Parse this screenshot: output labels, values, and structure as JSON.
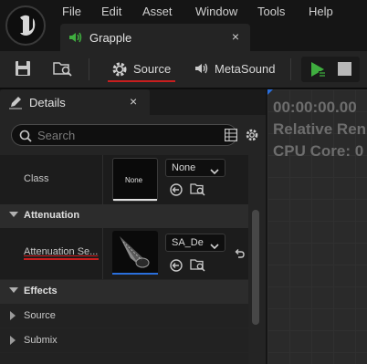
{
  "menu": {
    "items": [
      "File",
      "Edit",
      "Asset",
      "Window",
      "Tools",
      "Help"
    ]
  },
  "document_tab": {
    "label": "Grapple",
    "close_glyph": "×"
  },
  "toolbar": {
    "source_label": "Source",
    "metasound_label": "MetaSound"
  },
  "details": {
    "tab_label": "Details",
    "close_glyph": "×",
    "search_placeholder": "Search",
    "rows": {
      "class": {
        "label": "Class",
        "thumb_text": "None",
        "combo_value": "None"
      },
      "attenuation_category": "Attenuation",
      "attenuation_settings": {
        "label": "Attenuation Se...",
        "combo_value": "SA_De"
      },
      "effects_category": "Effects",
      "source_label": "Source",
      "submix_label": "Submix"
    }
  },
  "preview": {
    "line1": "00:00:00.00",
    "line2": "Relative Ren",
    "line3": "CPU Core: 0"
  },
  "colors": {
    "accent_red": "#c81e1e",
    "play_green": "#3fae3f",
    "selection_blue": "#2a6fdc"
  }
}
